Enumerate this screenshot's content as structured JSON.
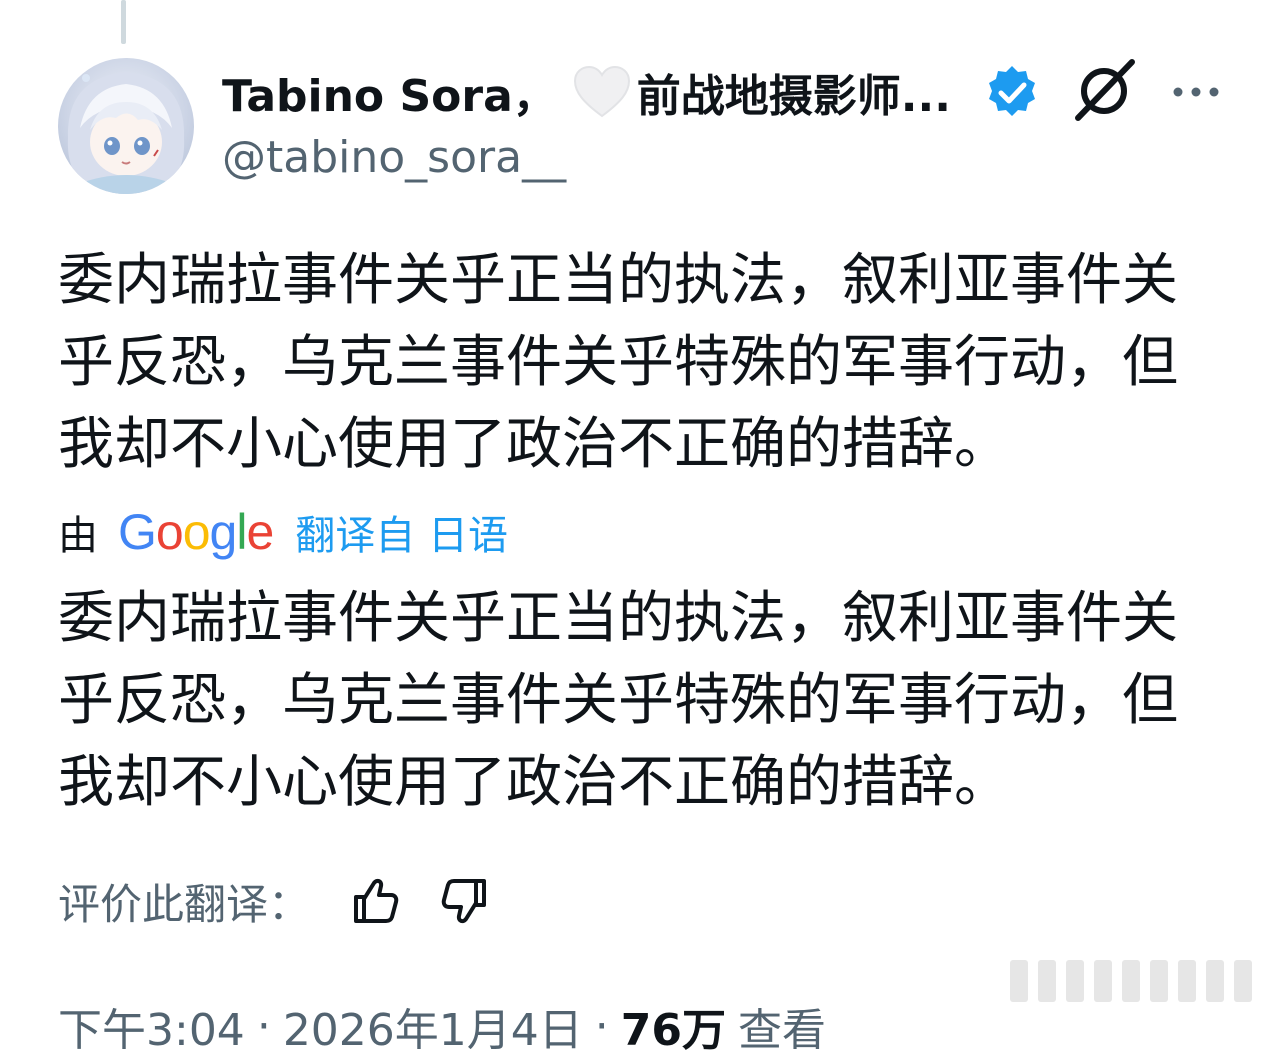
{
  "author": {
    "display_name": "Tabino Sora，",
    "name_suffix": "前战地摄影师...",
    "handle": "@tabino_sora__"
  },
  "tweet": {
    "original_text": "委内瑞拉事件关乎正当的执法，叙利亚事件关乎反恐，乌克兰事件关乎特殊的军事行动，但我却不小心使用了政治不正确的措辞。",
    "translated_text": "委内瑞拉事件关乎正当的执法，叙利亚事件关乎反恐，乌克兰事件关乎特殊的军事行动，但我却不小心使用了政治不正确的措辞。"
  },
  "translation": {
    "by_label": "由",
    "provider": "Google",
    "link_text": "翻译自 日语"
  },
  "rating": {
    "label": "评价此翻译："
  },
  "meta": {
    "time": "下午3:04",
    "separator": "·",
    "date": "2026年1月4日",
    "views": "76万",
    "views_label": "查看"
  },
  "colors": {
    "accent": "#1d9bf0",
    "secondary_text": "#536471",
    "primary_text": "#0f1419"
  },
  "icons": [
    "heart-icon",
    "verified-icon",
    "grok-icon",
    "more-icon",
    "thumb-up-icon",
    "thumb-down-icon"
  ]
}
